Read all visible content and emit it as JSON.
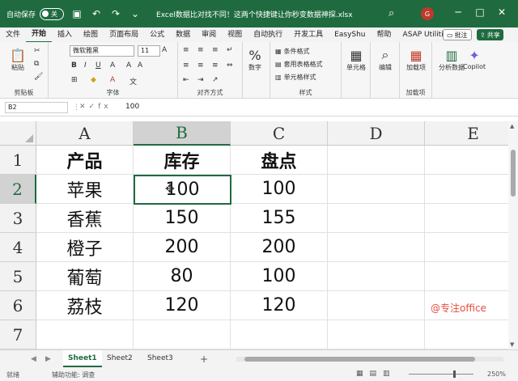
{
  "titlebar": {
    "autosave_label": "自动保存",
    "autosave_state": "关",
    "doc_title": "Excel数据比对找不同！这两个快捷键让你秒变数据神探.xlsx",
    "avatar": "G"
  },
  "menu": {
    "items": [
      "文件",
      "开始",
      "插入",
      "绘图",
      "页面布局",
      "公式",
      "数据",
      "审阅",
      "视图",
      "自动执行",
      "开发工具",
      "EasyShu",
      "帮助",
      "ASAP Utilities"
    ],
    "comment": "批注",
    "share": "共享"
  },
  "ribbon": {
    "paste": "粘贴",
    "clipboard": "剪贴板",
    "font_name": "微软雅黑",
    "font_size": "11",
    "font_group": "字体",
    "align_group": "对齐方式",
    "number": "数字",
    "cond_format": "条件格式",
    "table_format": "套用表格格式",
    "cell_style": "单元格样式",
    "style_group": "样式",
    "cells": "单元格",
    "edit": "编辑",
    "addin": "加载项",
    "addin_group": "加载项",
    "analyze": "分析数据",
    "copilot": "Copilot"
  },
  "formula_bar": {
    "name_box": "B2",
    "value": "100"
  },
  "grid": {
    "columns": [
      "A",
      "B",
      "C",
      "D",
      "E"
    ],
    "rows": [
      "1",
      "2",
      "3",
      "4",
      "5",
      "6",
      "7"
    ],
    "header": [
      "产品",
      "库存",
      "盘点"
    ],
    "data": [
      [
        "苹果",
        "100",
        "100"
      ],
      [
        "香蕉",
        "150",
        "155"
      ],
      [
        "橙子",
        "200",
        "200"
      ],
      [
        "葡萄",
        "80",
        "100"
      ],
      [
        "荔枝",
        "120",
        "120"
      ]
    ],
    "watermark": "@专注office"
  },
  "sheets": {
    "tabs": [
      "Sheet1",
      "Sheet2",
      "Sheet3"
    ],
    "add": "+"
  },
  "status": {
    "ready": "就绪",
    "accessibility": "辅助功能: 调查",
    "zoom": "250%"
  }
}
